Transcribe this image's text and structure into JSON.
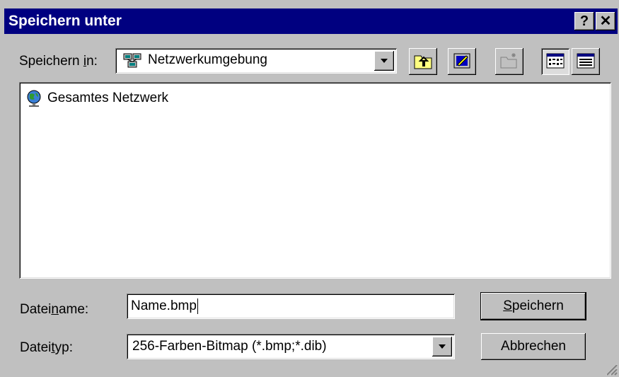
{
  "window": {
    "title": "Speichern unter",
    "help_button": "?",
    "close_button": "✕"
  },
  "location": {
    "label_pre": "Speichern ",
    "label_accel": "i",
    "label_post": "n:",
    "value": "Netzwerkumgebung",
    "icon": "network-neighborhood-icon"
  },
  "toolbar": {
    "buttons": [
      {
        "name": "up-one-level",
        "icon": "folder-up-icon"
      },
      {
        "name": "desktop",
        "icon": "desktop-icon"
      },
      {
        "name": "new-folder",
        "icon": "new-folder-icon",
        "disabled": true
      },
      {
        "name": "list-view",
        "icon": "list-view-icon",
        "pressed": true
      },
      {
        "name": "details-view",
        "icon": "details-view-icon"
      }
    ]
  },
  "file_list": {
    "items": [
      {
        "label": "Gesamtes Netzwerk",
        "icon": "globe-network-icon"
      }
    ]
  },
  "filename": {
    "label_pre": "Datei",
    "label_accel": "n",
    "label_post": "ame:",
    "value": "Name.bmp"
  },
  "filetype": {
    "label_pre": "Datei",
    "label_accel": "t",
    "label_post": "yp:",
    "value": "256-Farben-Bitmap (*.bmp;*.dib)"
  },
  "buttons": {
    "save_accel": "S",
    "save_rest": "peichern",
    "cancel": "Abbrechen"
  },
  "colors": {
    "titlebar": "#000080",
    "face": "#c0c0c0"
  }
}
